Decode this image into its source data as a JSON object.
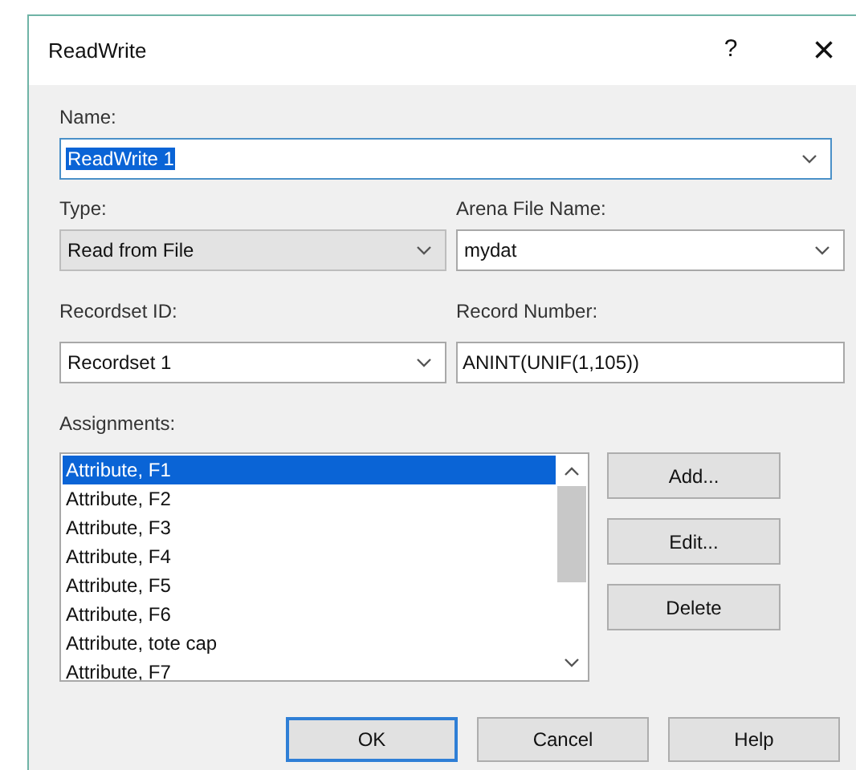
{
  "window": {
    "title": "ReadWrite",
    "help": "?",
    "close": "×"
  },
  "name": {
    "label": "Name:",
    "value": "ReadWrite 1"
  },
  "type": {
    "label": "Type:",
    "value": "Read from File",
    "disabled": true
  },
  "arena_file_name": {
    "label": "Arena File Name:",
    "value": "mydat"
  },
  "recordset_id": {
    "label": "Recordset ID:",
    "value": "Recordset 1"
  },
  "record_number": {
    "label": "Record Number:",
    "value": "ANINT(UNIF(1,105))"
  },
  "assignments": {
    "label": "Assignments:",
    "items": [
      {
        "text": "Attribute, F1",
        "selected": true
      },
      {
        "text": "Attribute, F2",
        "selected": false
      },
      {
        "text": "Attribute, F3",
        "selected": false
      },
      {
        "text": "Attribute, F4",
        "selected": false
      },
      {
        "text": "Attribute, F5",
        "selected": false
      },
      {
        "text": "Attribute, F6",
        "selected": false
      },
      {
        "text": "Attribute, tote cap",
        "selected": false
      },
      {
        "text": "Attribute, F7",
        "selected": false
      }
    ]
  },
  "side_buttons": [
    "Add...",
    "Edit...",
    "Delete"
  ],
  "buttons": [
    {
      "label": "OK",
      "default": true
    },
    {
      "label": "Cancel",
      "default": false
    },
    {
      "label": "Help",
      "default": false
    }
  ]
}
